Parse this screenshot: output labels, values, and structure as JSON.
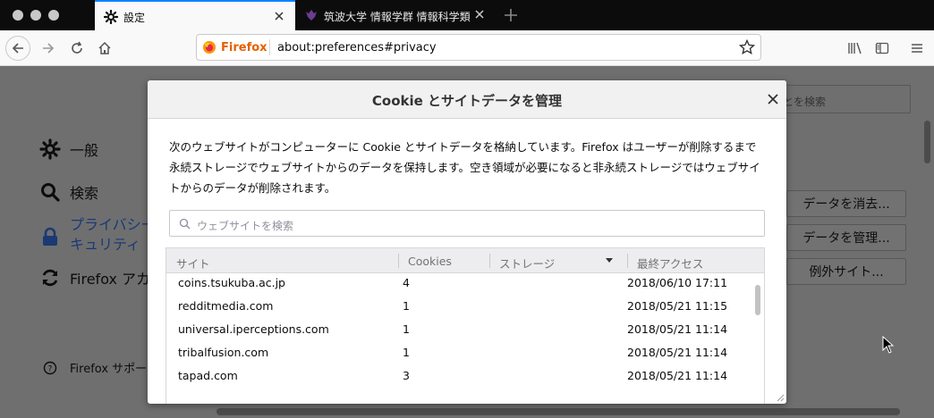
{
  "tabs": [
    {
      "title": "設定",
      "active": true,
      "icon": "gear-icon"
    },
    {
      "title": "筑波大学 情報学群 情報科学類 | こ",
      "active": false,
      "icon": "university-logo-icon"
    }
  ],
  "url": {
    "identity": "Firefox",
    "address": "about:preferences#privacy"
  },
  "sidebar": {
    "items": [
      {
        "label": "一般",
        "icon": "gear-icon"
      },
      {
        "label": "検索",
        "icon": "search-icon"
      },
      {
        "label": "プライバシー\nキュリティ",
        "line1": "プライバシー",
        "line2": "キュリティ",
        "icon": "lock-icon"
      },
      {
        "label": "Firefox アカ",
        "icon": "sync-icon"
      }
    ],
    "support": "Firefox サポー"
  },
  "page": {
    "search_placeholder": "とを検索",
    "buttons": [
      "データを消去...",
      "データを管理...",
      "例外サイト..."
    ]
  },
  "dialog": {
    "title": "Cookie とサイトデータを管理",
    "description": "次のウェブサイトがコンピューターに Cookie とサイトデータを格納しています。Firefox はユーザーが削除するまで永続ストレージでウェブサイトからのデータを保持します。空き領域が必要になると非永続ストレージではウェブサイトからのデータが削除されます。",
    "search_placeholder": "ウェブサイトを検索",
    "columns": [
      "サイト",
      "Cookies",
      "ストレージ",
      "最終アクセス"
    ],
    "rows": [
      {
        "site": "coins.tsukuba.ac.jp",
        "cookies": "4",
        "storage": "",
        "last": "2018/06/10 17:11"
      },
      {
        "site": "redditmedia.com",
        "cookies": "1",
        "storage": "",
        "last": "2018/05/21 11:15"
      },
      {
        "site": "universal.iperceptions.com",
        "cookies": "1",
        "storage": "",
        "last": "2018/05/21 11:14"
      },
      {
        "site": "tribalfusion.com",
        "cookies": "1",
        "storage": "",
        "last": "2018/05/21 11:14"
      },
      {
        "site": "tapad.com",
        "cookies": "3",
        "storage": "",
        "last": "2018/05/21 11:14"
      }
    ]
  },
  "colors": {
    "accent": "#0a84ff",
    "firefox_orange": "#e66000"
  }
}
